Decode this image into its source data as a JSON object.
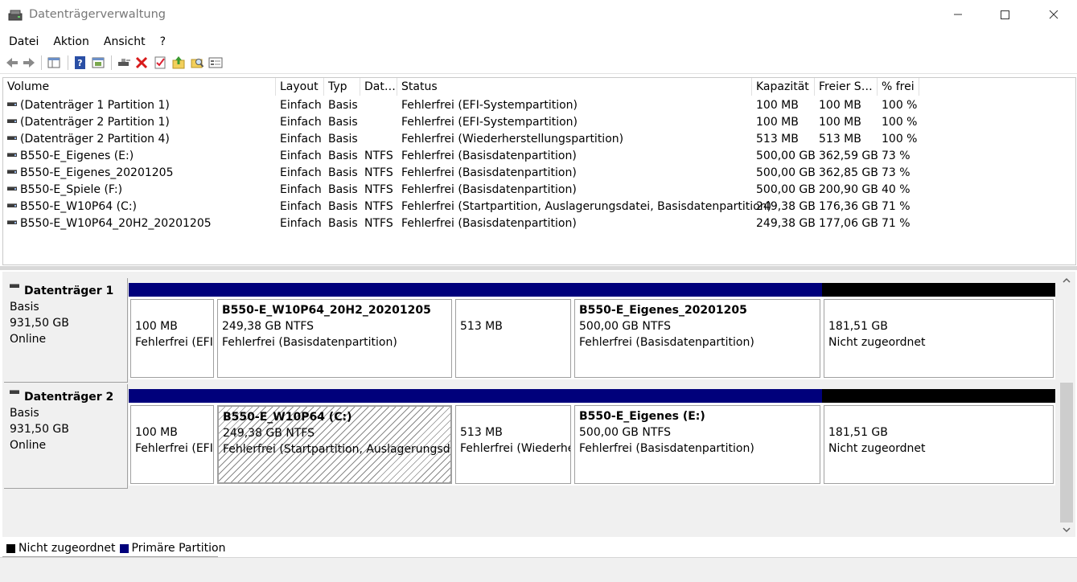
{
  "window": {
    "title": "Datenträgerverwaltung"
  },
  "menu": [
    "Datei",
    "Aktion",
    "Ansicht",
    "?"
  ],
  "toolbar": [
    {
      "name": "back-arrow-icon"
    },
    {
      "name": "forward-arrow-icon"
    },
    {
      "name": "console-tree-icon"
    },
    {
      "name": "help-icon"
    },
    {
      "name": "properties-icon"
    },
    {
      "name": "connect-disk-icon"
    },
    {
      "name": "delete-icon"
    },
    {
      "name": "checklist-icon"
    },
    {
      "name": "up-folder-icon"
    },
    {
      "name": "search-folder-icon"
    },
    {
      "name": "console-view-icon"
    }
  ],
  "columns": [
    "Volume",
    "Layout",
    "Typ",
    "Dat…",
    "Status",
    "Kapazität",
    "Freier S…",
    "% frei"
  ],
  "volumes": [
    {
      "volume": "(Datenträger 1 Partition 1)",
      "layout": "Einfach",
      "type": "Basis",
      "fs": "",
      "status": "Fehlerfrei (EFI-Systempartition)",
      "capacity": "100 MB",
      "free": "100 MB",
      "pct": "100 %"
    },
    {
      "volume": "(Datenträger 2 Partition 1)",
      "layout": "Einfach",
      "type": "Basis",
      "fs": "",
      "status": "Fehlerfrei (EFI-Systempartition)",
      "capacity": "100 MB",
      "free": "100 MB",
      "pct": "100 %"
    },
    {
      "volume": "(Datenträger 2 Partition 4)",
      "layout": "Einfach",
      "type": "Basis",
      "fs": "",
      "status": "Fehlerfrei (Wiederherstellungspartition)",
      "capacity": "513 MB",
      "free": "513 MB",
      "pct": "100 %"
    },
    {
      "volume": "B550-E_Eigenes (E:)",
      "layout": "Einfach",
      "type": "Basis",
      "fs": "NTFS",
      "status": "Fehlerfrei (Basisdatenpartition)",
      "capacity": "500,00 GB",
      "free": "362,59 GB",
      "pct": "73 %"
    },
    {
      "volume": "B550-E_Eigenes_20201205",
      "layout": "Einfach",
      "type": "Basis",
      "fs": "NTFS",
      "status": "Fehlerfrei (Basisdatenpartition)",
      "capacity": "500,00 GB",
      "free": "362,85 GB",
      "pct": "73 %"
    },
    {
      "volume": "B550-E_Spiele (F:)",
      "layout": "Einfach",
      "type": "Basis",
      "fs": "NTFS",
      "status": "Fehlerfrei (Basisdatenpartition)",
      "capacity": "500,00 GB",
      "free": "200,90 GB",
      "pct": "40 %"
    },
    {
      "volume": "B550-E_W10P64 (C:)",
      "layout": "Einfach",
      "type": "Basis",
      "fs": "NTFS",
      "status": "Fehlerfrei (Startpartition, Auslagerungsdatei, Basisdatenpartition)",
      "capacity": "249,38 GB",
      "free": "176,36 GB",
      "pct": "71 %"
    },
    {
      "volume": "B550-E_W10P64_20H2_20201205",
      "layout": "Einfach",
      "type": "Basis",
      "fs": "NTFS",
      "status": "Fehlerfrei (Basisdatenpartition)",
      "capacity": "249,38 GB",
      "free": "177,06 GB",
      "pct": "71 %"
    }
  ],
  "disks": [
    {
      "name": "Datenträger 1",
      "type": "Basis",
      "size": "931,50 GB",
      "state": "Online",
      "partitions": [
        {
          "title": "",
          "size": "100 MB",
          "status": "Fehlerfrei (EFI-Systempartition)",
          "kind": "primary",
          "selected": false
        },
        {
          "title": "B550-E_W10P64_20H2_20201205",
          "size": "249,38 GB NTFS",
          "status": "Fehlerfrei (Basisdatenpartition)",
          "kind": "primary",
          "selected": false
        },
        {
          "title": "",
          "size": "513 MB",
          "status": "",
          "kind": "primary",
          "selected": false
        },
        {
          "title": "B550-E_Eigenes_20201205",
          "size": "500,00 GB NTFS",
          "status": "Fehlerfrei (Basisdatenpartition)",
          "kind": "primary",
          "selected": false
        },
        {
          "title": "",
          "size": "181,51 GB",
          "status": "Nicht zugeordnet",
          "kind": "unallocated",
          "selected": false
        }
      ]
    },
    {
      "name": "Datenträger 2",
      "type": "Basis",
      "size": "931,50 GB",
      "state": "Online",
      "partitions": [
        {
          "title": "",
          "size": "100 MB",
          "status": "Fehlerfrei (EFI-Systempartition)",
          "kind": "primary",
          "selected": false
        },
        {
          "title": "B550-E_W10P64  (C:)",
          "size": "249,38 GB NTFS",
          "status": "Fehlerfrei (Startpartition, Auslagerungsdatei, Basisdatenpartition)",
          "kind": "primary",
          "selected": true
        },
        {
          "title": "",
          "size": "513 MB",
          "status": "Fehlerfrei (Wiederherstellungspartition)",
          "kind": "primary",
          "selected": false
        },
        {
          "title": "B550-E_Eigenes  (E:)",
          "size": "500,00 GB NTFS",
          "status": "Fehlerfrei (Basisdatenpartition)",
          "kind": "primary",
          "selected": false
        },
        {
          "title": "",
          "size": "181,51 GB",
          "status": "Nicht zugeordnet",
          "kind": "unallocated",
          "selected": false
        }
      ]
    }
  ],
  "legend": [
    {
      "label": "Nicht zugeordnet",
      "color": "#000000"
    },
    {
      "label": "Primäre Partition",
      "color": "#00007b"
    }
  ],
  "colors": {
    "primary": "#00007b",
    "unallocated": "#000000"
  }
}
